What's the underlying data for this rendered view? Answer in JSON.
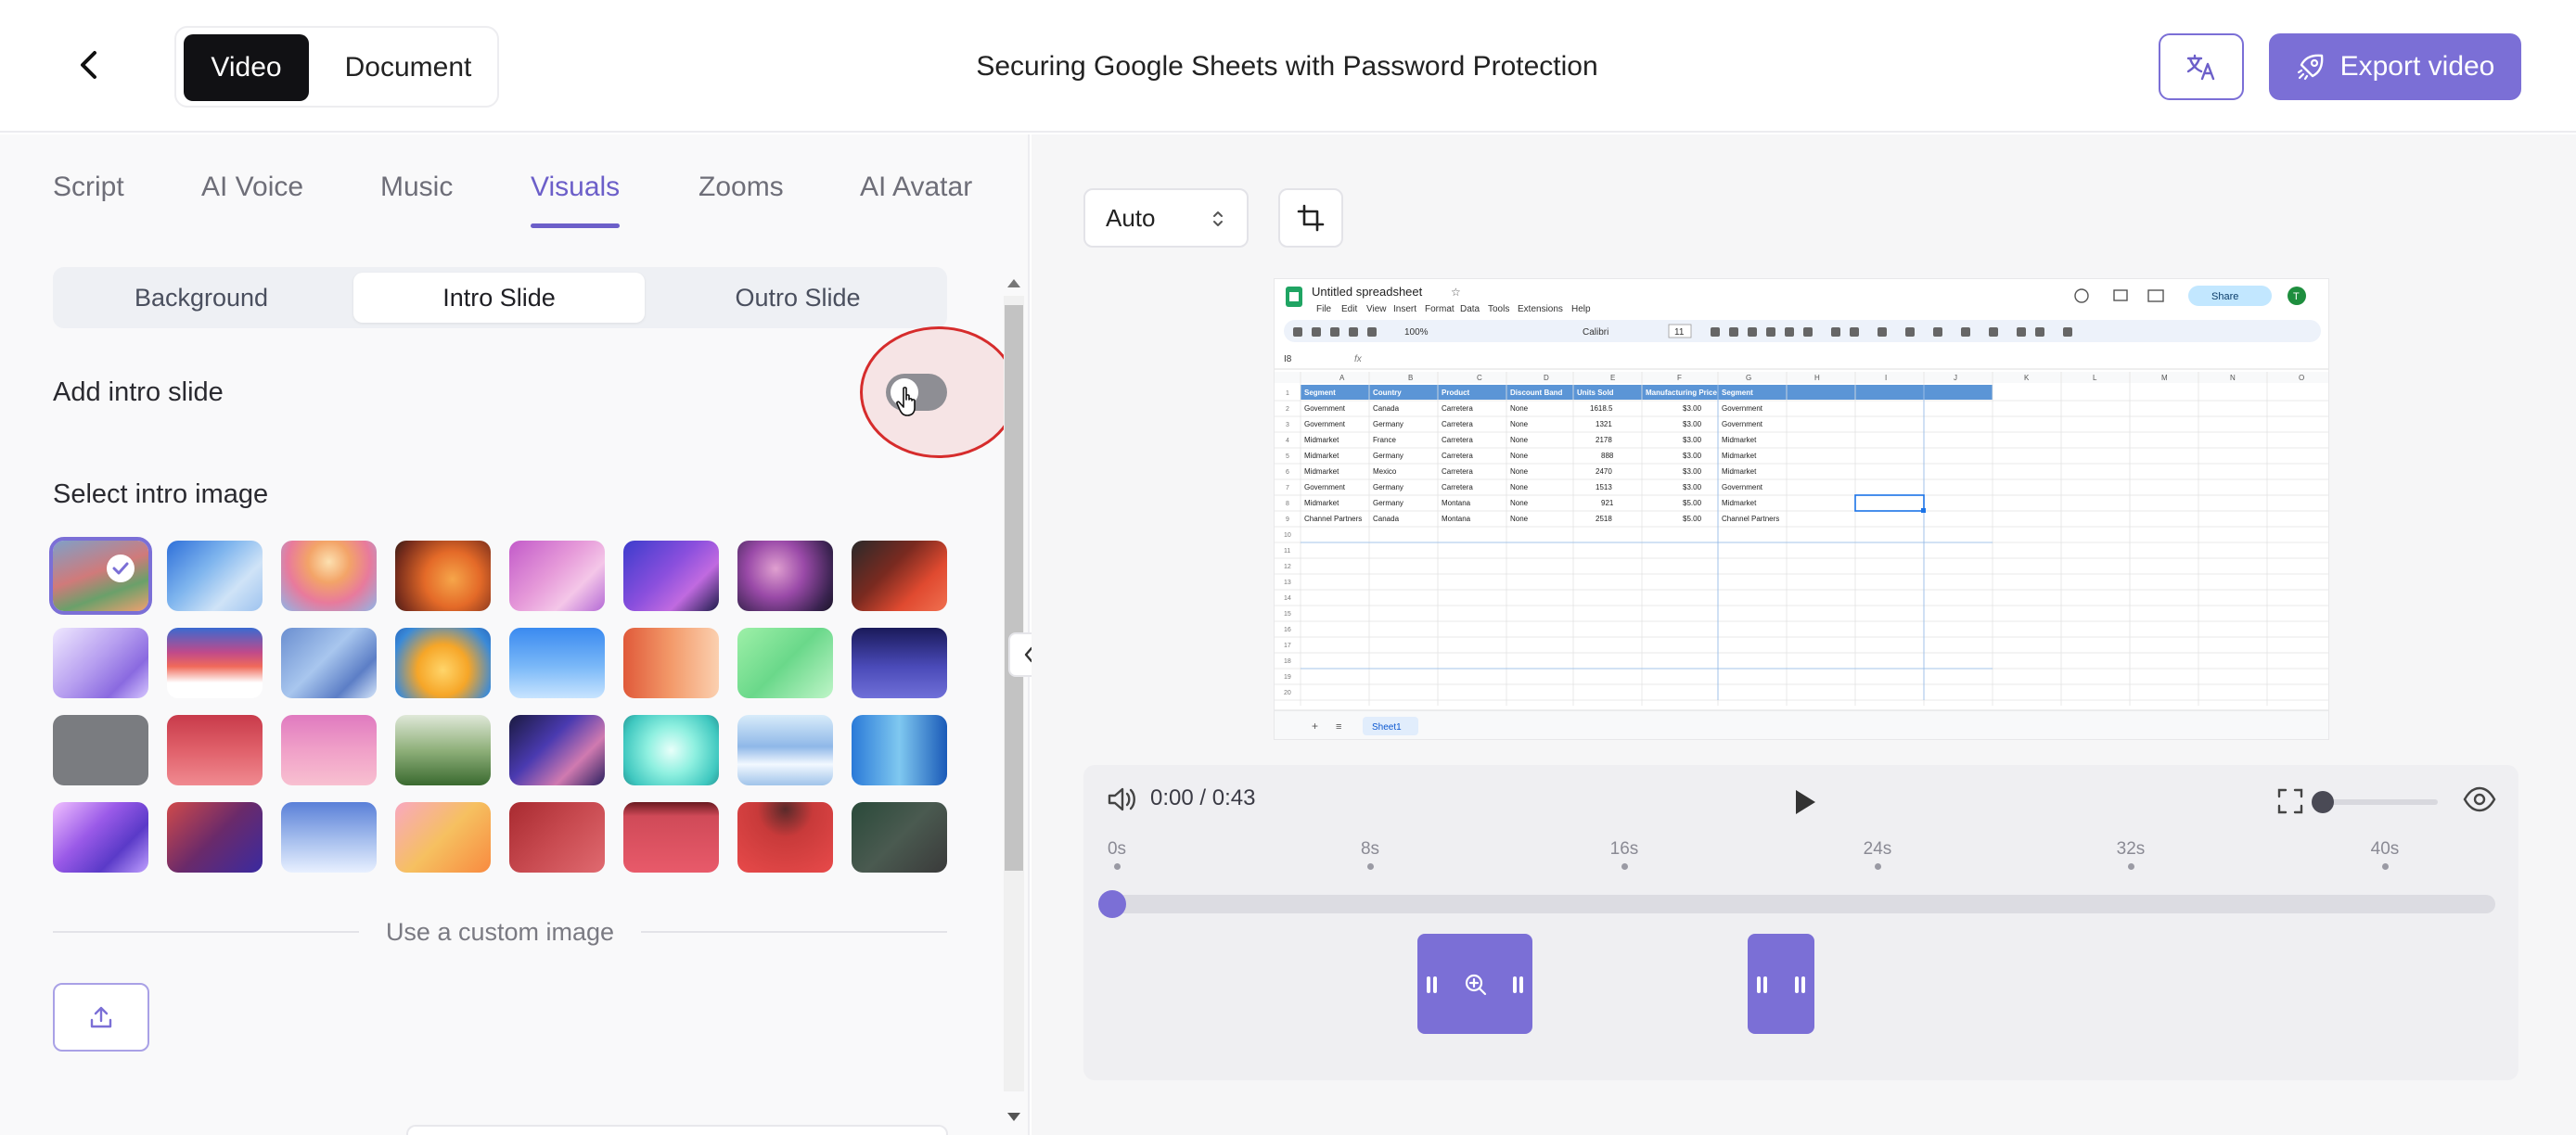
{
  "header": {
    "back_icon": "chevron-left-icon",
    "mode_video": "Video",
    "mode_document": "Document",
    "title": "Securing Google Sheets with Password Protection",
    "translate_icon": "translate-icon",
    "export_label": "Export video",
    "export_icon": "rocket-icon",
    "accent_color": "#7b6fd6"
  },
  "tabs": [
    "Script",
    "AI Voice",
    "Music",
    "Visuals",
    "Zooms",
    "AI Avatar"
  ],
  "active_tab": "Visuals",
  "subtabs": [
    "Background",
    "Intro Slide",
    "Outro Slide"
  ],
  "active_subtab": "Intro Slide",
  "intro": {
    "add_intro_label": "Add intro slide",
    "add_intro_enabled": false,
    "select_image_label": "Select intro image",
    "selected_index": 0,
    "custom_image_label": "Use a custom image",
    "upload_icon": "upload-icon"
  },
  "preview": {
    "aspect_select": "Auto",
    "crop_icon": "crop-icon",
    "spreadsheet": {
      "title": "Untitled spreadsheet",
      "menu": [
        "File",
        "Edit",
        "View",
        "Insert",
        "Format",
        "Data",
        "Tools",
        "Extensions",
        "Help"
      ],
      "toolbar_zoom": "100%",
      "toolbar_font": "Calibri",
      "toolbar_size": "11",
      "share_label": "Share",
      "avatar_letter": "T",
      "name_box": "I8",
      "fx": "fx",
      "column_letters": [
        "A",
        "B",
        "C",
        "D",
        "E",
        "F",
        "G",
        "H",
        "I",
        "J",
        "K",
        "L",
        "M",
        "N",
        "O"
      ],
      "headers": [
        "Segment",
        "Country",
        "Product",
        "Discount Band",
        "Units Sold",
        "Manufacturing Price",
        "Segment"
      ],
      "rows": [
        [
          "Government",
          "Canada",
          "Carretera",
          "None",
          "1618.5",
          "$3.00",
          "Government"
        ],
        [
          "Government",
          "Germany",
          "Carretera",
          "None",
          "1321",
          "$3.00",
          "Government"
        ],
        [
          "Midmarket",
          "France",
          "Carretera",
          "None",
          "2178",
          "$3.00",
          "Midmarket"
        ],
        [
          "Midmarket",
          "Germany",
          "Carretera",
          "None",
          "888",
          "$3.00",
          "Midmarket"
        ],
        [
          "Midmarket",
          "Mexico",
          "Carretera",
          "None",
          "2470",
          "$3.00",
          "Midmarket"
        ],
        [
          "Government",
          "Germany",
          "Carretera",
          "None",
          "1513",
          "$3.00",
          "Government"
        ],
        [
          "Midmarket",
          "Germany",
          "Montana",
          "None",
          "921",
          "$5.00",
          "Midmarket"
        ],
        [
          "Channel Partners",
          "Canada",
          "Montana",
          "None",
          "2518",
          "$5.00",
          "Channel Partners"
        ]
      ],
      "sheet_tab": "Sheet1"
    }
  },
  "player": {
    "time": "0:00 / 0:43",
    "volume_icon": "volume-icon",
    "play_icon": "play-icon",
    "fullscreen_icon": "fullscreen-icon",
    "eye_icon": "eye-icon",
    "zoom_level": 0,
    "ticks": [
      "0s",
      "8s",
      "16s",
      "24s",
      "32s",
      "40s"
    ],
    "playhead_fraction": 0
  }
}
